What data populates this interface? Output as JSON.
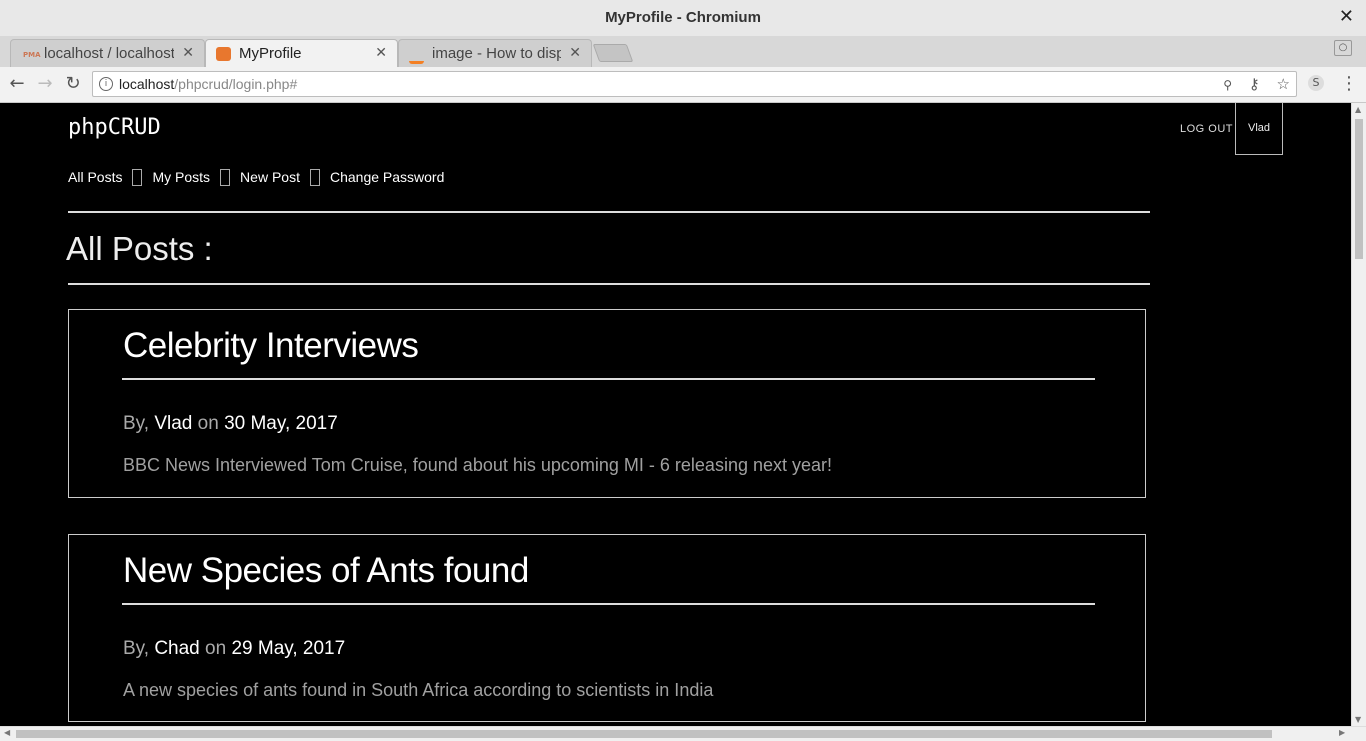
{
  "window": {
    "title": "MyProfile - Chromium",
    "close_glyph": "✕"
  },
  "tabs": [
    {
      "label": "localhost / localhost",
      "favicon_color": "#f1a33a",
      "favicon_text": "PMA"
    },
    {
      "label": "MyProfile",
      "favicon_color": "#e8772e"
    },
    {
      "label": "image - How to display",
      "favicon_color": "#f48024"
    }
  ],
  "toolbar": {
    "back": "←",
    "forward": "→",
    "reload": "↻",
    "url_host": "localhost",
    "url_path": "/phpcrud/login.php#",
    "info_icon": "i",
    "zoom_icon": "🔍",
    "key_icon": "⚷",
    "star_icon": "☆",
    "ext_label": "S",
    "menu": "⋮",
    "profile": "👤"
  },
  "site": {
    "brand": "phpCRUD",
    "logout": "LOG OUT",
    "username": "Vlad",
    "nav": [
      "All Posts",
      "My Posts",
      "New Post",
      "Change Password"
    ],
    "heading": "All Posts :"
  },
  "posts": [
    {
      "title": "Celebrity Interviews",
      "by": "By,",
      "author": "Vlad",
      "on": "on",
      "date": "30 May, 2017",
      "body": "BBC News Interviewed Tom Cruise, found about his upcoming MI - 6 releasing next year!"
    },
    {
      "title": "New Species of Ants found",
      "by": "By,",
      "author": "Chad",
      "on": "on",
      "date": "29 May, 2017",
      "body": "A new species of ants found in South Africa according to scientists in India"
    }
  ]
}
